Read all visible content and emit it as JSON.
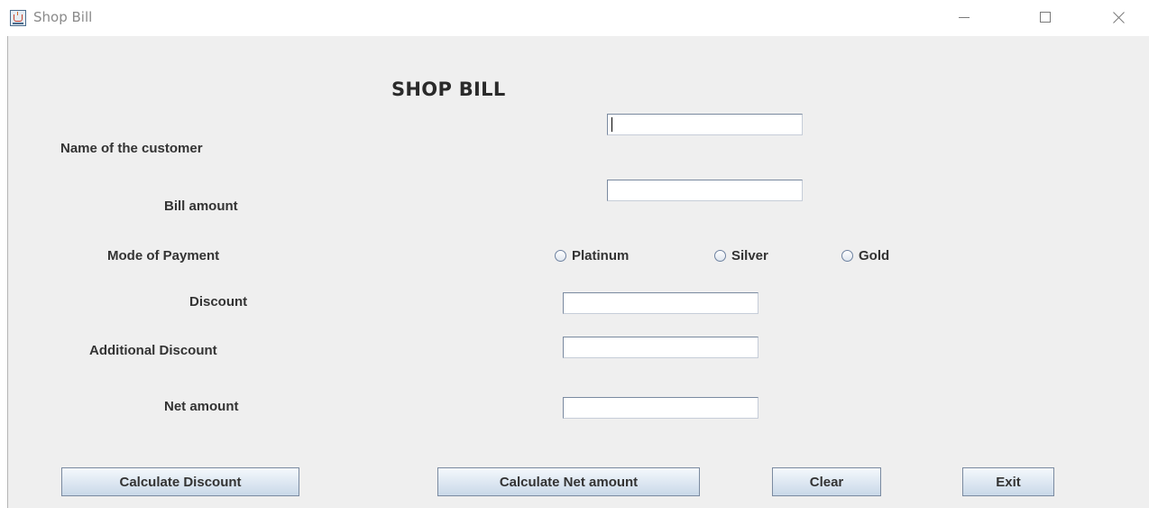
{
  "window": {
    "title": "Shop Bill"
  },
  "form": {
    "heading": "SHOP BILL",
    "labels": {
      "customer_name": "Name of the customer",
      "bill_amount": "Bill amount",
      "mode_of_payment": "Mode of Payment",
      "discount": "Discount",
      "additional_discount": "Additional Discount",
      "net_amount": "Net amount"
    },
    "fields": {
      "customer_name": "",
      "bill_amount": "",
      "discount": "",
      "additional_discount": "",
      "net_amount": ""
    },
    "payment_options": [
      "Platinum",
      "Silver",
      "Gold"
    ]
  },
  "buttons": {
    "calculate_discount": "Calculate Discount",
    "calculate_net_amount": "Calculate Net amount",
    "clear": "Clear",
    "exit": "Exit"
  },
  "icons": {
    "app": "java-coffee-cup-icon",
    "minimize": "minimize-icon",
    "maximize": "maximize-icon",
    "close": "close-icon",
    "radio": "radio-unselected-icon"
  }
}
